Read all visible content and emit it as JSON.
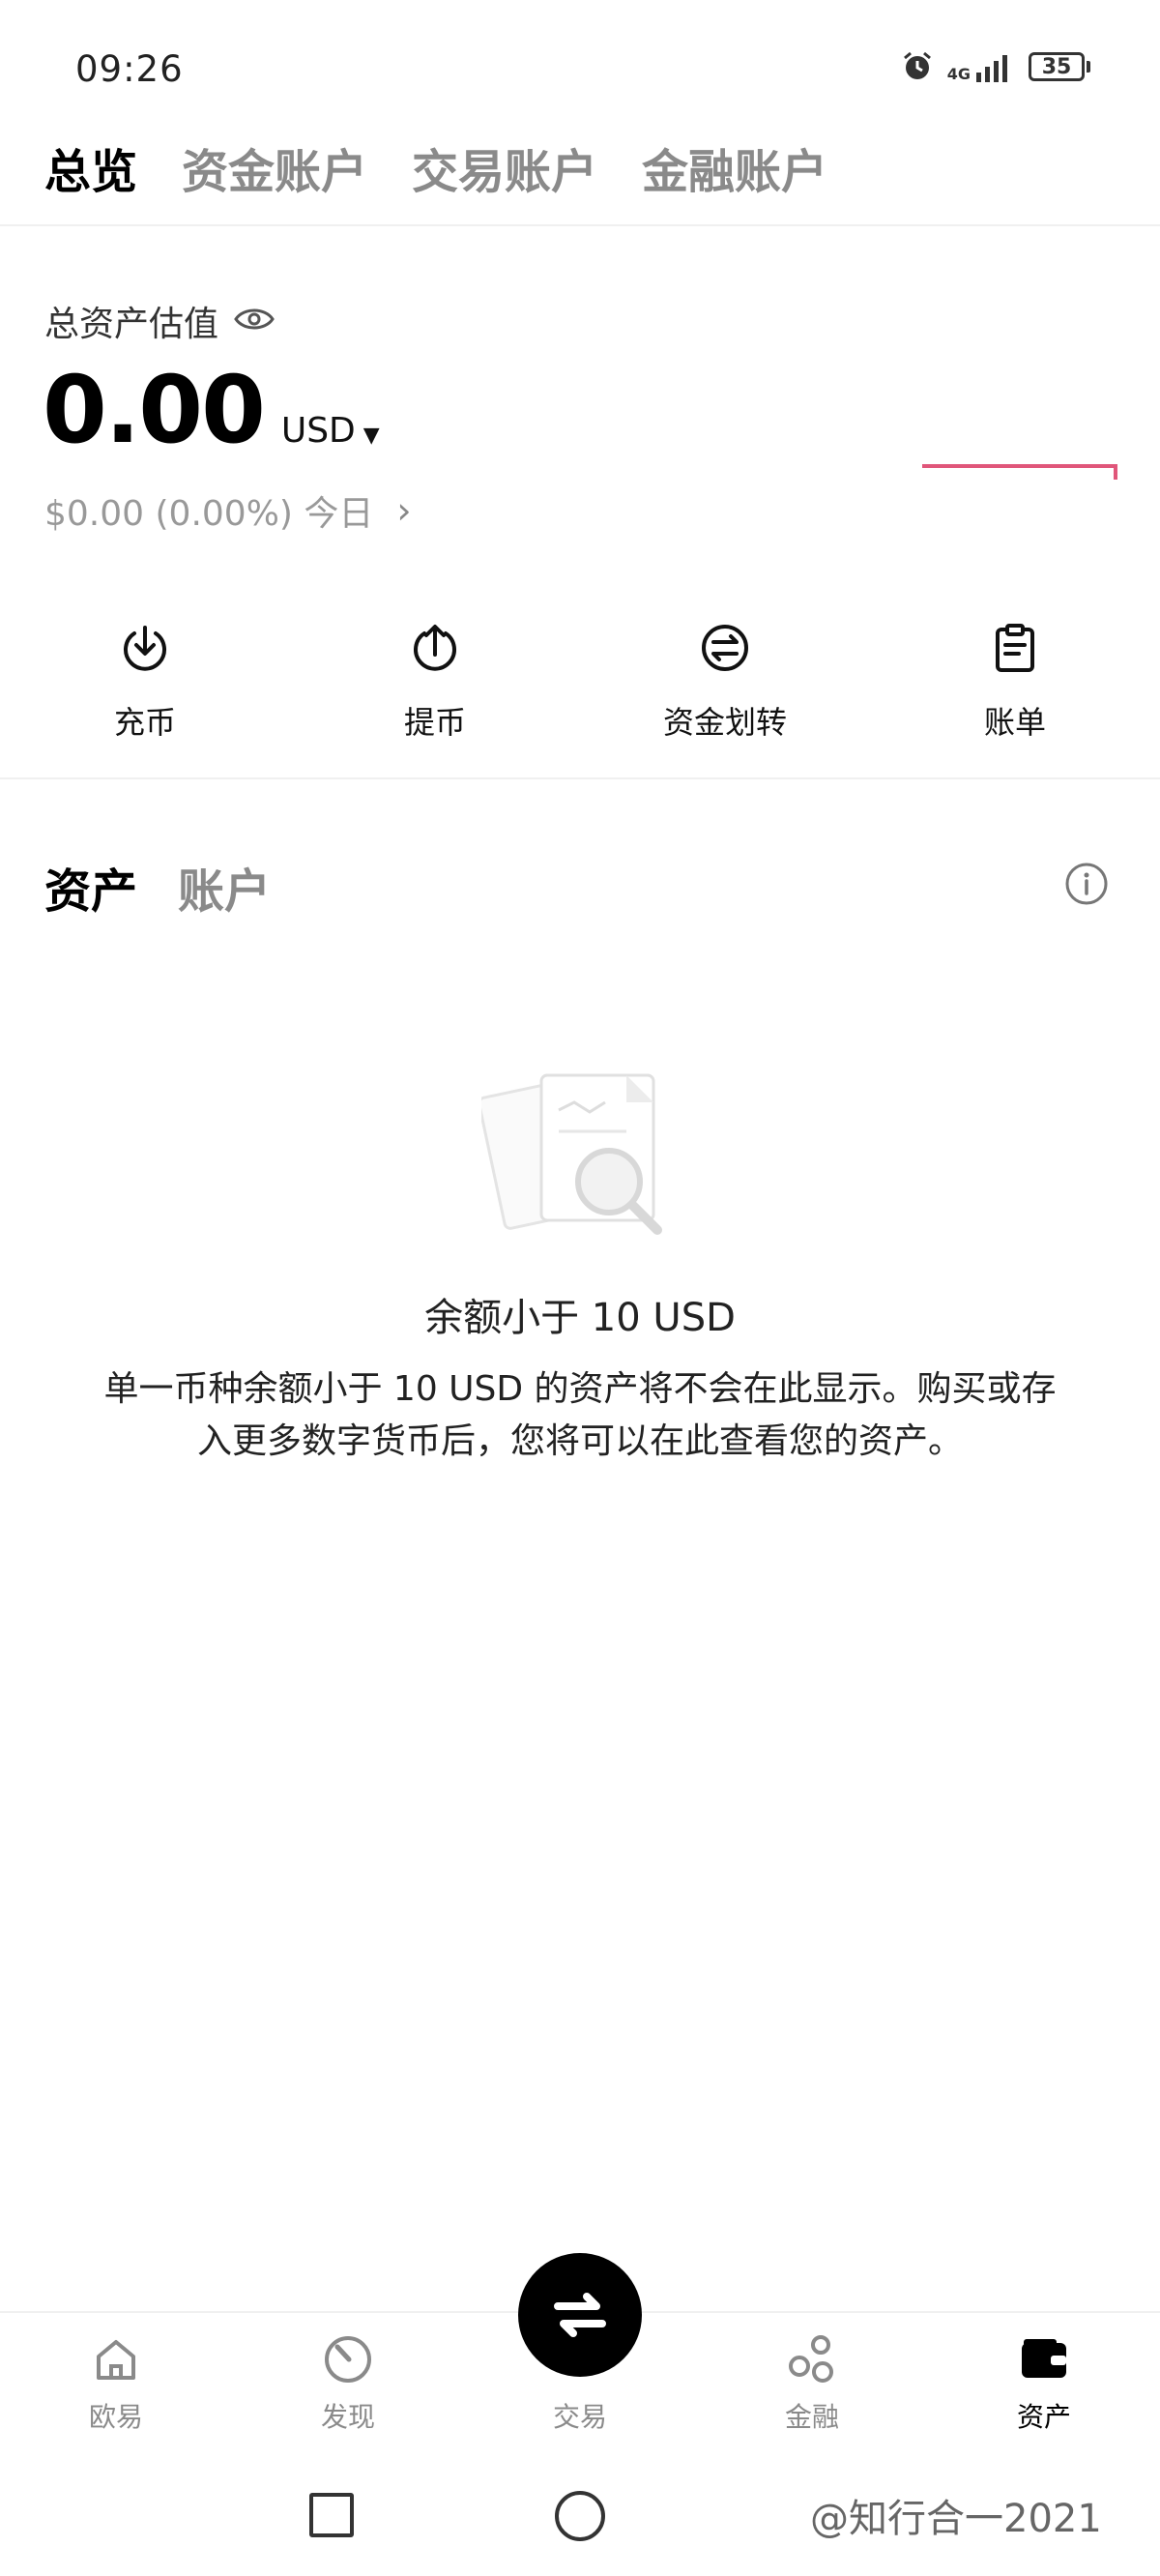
{
  "status_bar": {
    "time": "09:26",
    "signal_label": "4G",
    "battery_level": "35",
    "icons": [
      "alarm-icon",
      "signal-icon",
      "battery-icon"
    ]
  },
  "top_tabs": [
    {
      "label": "总览",
      "active": true
    },
    {
      "label": "资金账户",
      "active": false
    },
    {
      "label": "交易账户",
      "active": false
    },
    {
      "label": "金融账户",
      "active": false
    }
  ],
  "summary": {
    "label": "总资产估值",
    "value": "0.00",
    "currency": "USD",
    "daily_change": "$0.00 (0.00%) 今日",
    "sparkline_color": "#e0567a"
  },
  "actions": [
    {
      "label": "充币",
      "icon": "deposit-icon"
    },
    {
      "label": "提币",
      "icon": "withdraw-icon"
    },
    {
      "label": "资金划转",
      "icon": "transfer-icon"
    },
    {
      "label": "账单",
      "icon": "bill-icon"
    }
  ],
  "section_tabs": [
    {
      "label": "资产",
      "active": true
    },
    {
      "label": "账户",
      "active": false
    }
  ],
  "empty_state": {
    "title": "余额小于 10 USD",
    "description": "单一币种余额小于 10 USD 的资产将不会在此显示。购买或存入更多数字货币后，您将可以在此查看您的资产。"
  },
  "bottom_nav": [
    {
      "label": "欧易",
      "icon": "home-icon",
      "active": false
    },
    {
      "label": "发现",
      "icon": "discover-icon",
      "active": false
    },
    {
      "label": "交易",
      "icon": "trade-icon",
      "active": false
    },
    {
      "label": "金融",
      "icon": "finance-icon",
      "active": false
    },
    {
      "label": "资产",
      "icon": "wallet-icon",
      "active": true
    }
  ],
  "watermark": "@知行合一2021",
  "colors": {
    "primary": "#000000",
    "inactive": "#8a8a8a",
    "accent_line": "#e0567a"
  }
}
